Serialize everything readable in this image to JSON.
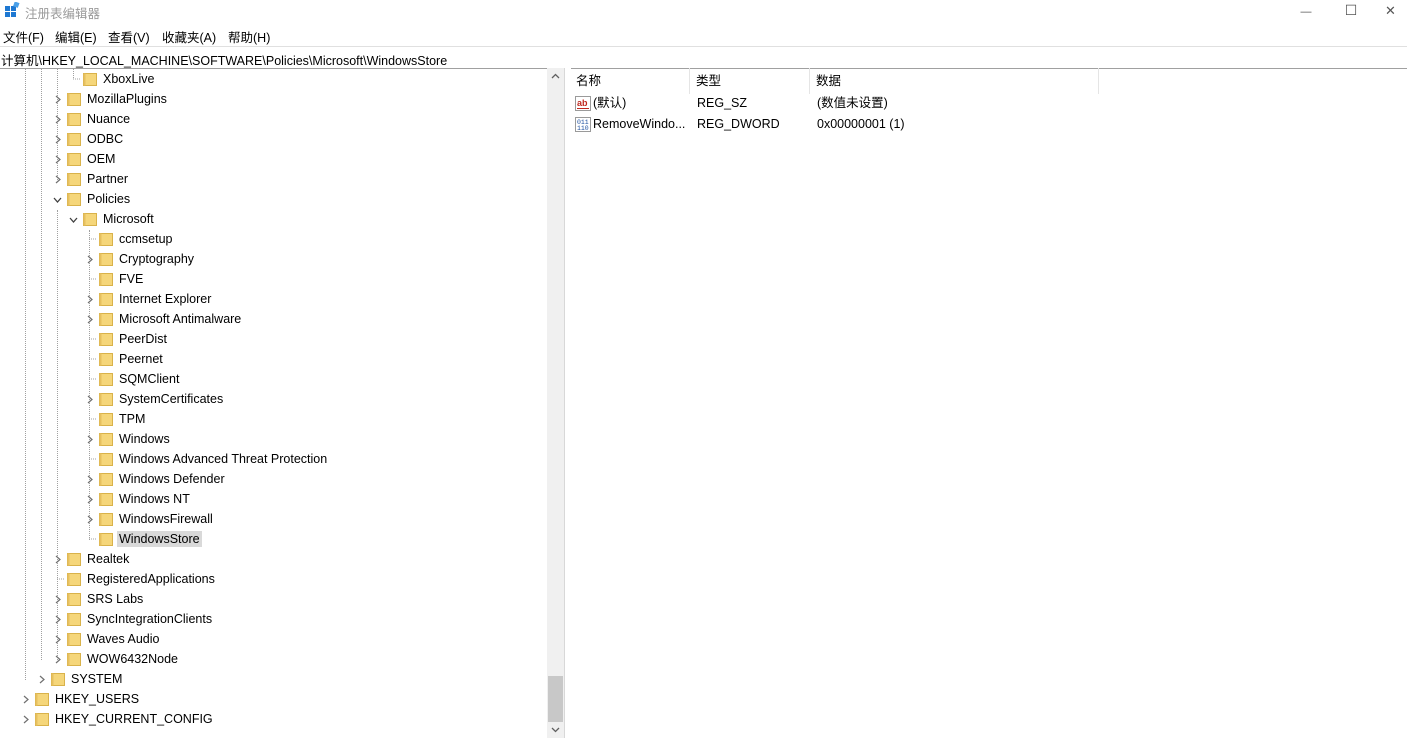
{
  "window": {
    "title": "注册表编辑器",
    "minimize_glyph": "—",
    "maximize_glyph": "☐",
    "close_glyph": "✕"
  },
  "menu": [
    "文件(F)",
    "编辑(E)",
    "查看(V)",
    "收藏夹(A)",
    "帮助(H)"
  ],
  "address": "计算机\\HKEY_LOCAL_MACHINE\\SOFTWARE\\Policies\\Microsoft\\WindowsStore",
  "tree": [
    {
      "label": "XboxLive",
      "depth": 3,
      "expander": "none",
      "selected": false
    },
    {
      "label": "MozillaPlugins",
      "depth": 2,
      "expander": "collapsed",
      "selected": false
    },
    {
      "label": "Nuance",
      "depth": 2,
      "expander": "collapsed",
      "selected": false
    },
    {
      "label": "ODBC",
      "depth": 2,
      "expander": "collapsed",
      "selected": false
    },
    {
      "label": "OEM",
      "depth": 2,
      "expander": "collapsed",
      "selected": false
    },
    {
      "label": "Partner",
      "depth": 2,
      "expander": "collapsed",
      "selected": false
    },
    {
      "label": "Policies",
      "depth": 2,
      "expander": "expanded",
      "selected": false
    },
    {
      "label": "Microsoft",
      "depth": 3,
      "expander": "expanded",
      "selected": false
    },
    {
      "label": "ccmsetup",
      "depth": 4,
      "expander": "none",
      "selected": false
    },
    {
      "label": "Cryptography",
      "depth": 4,
      "expander": "collapsed",
      "selected": false
    },
    {
      "label": "FVE",
      "depth": 4,
      "expander": "none",
      "selected": false
    },
    {
      "label": "Internet Explorer",
      "depth": 4,
      "expander": "collapsed",
      "selected": false
    },
    {
      "label": "Microsoft Antimalware",
      "depth": 4,
      "expander": "collapsed",
      "selected": false
    },
    {
      "label": "PeerDist",
      "depth": 4,
      "expander": "none",
      "selected": false
    },
    {
      "label": "Peernet",
      "depth": 4,
      "expander": "none",
      "selected": false
    },
    {
      "label": "SQMClient",
      "depth": 4,
      "expander": "none",
      "selected": false
    },
    {
      "label": "SystemCertificates",
      "depth": 4,
      "expander": "collapsed",
      "selected": false
    },
    {
      "label": "TPM",
      "depth": 4,
      "expander": "none",
      "selected": false
    },
    {
      "label": "Windows",
      "depth": 4,
      "expander": "collapsed",
      "selected": false
    },
    {
      "label": "Windows Advanced Threat Protection",
      "depth": 4,
      "expander": "none",
      "selected": false
    },
    {
      "label": "Windows Defender",
      "depth": 4,
      "expander": "collapsed",
      "selected": false
    },
    {
      "label": "Windows NT",
      "depth": 4,
      "expander": "collapsed",
      "selected": false
    },
    {
      "label": "WindowsFirewall",
      "depth": 4,
      "expander": "collapsed",
      "selected": false
    },
    {
      "label": "WindowsStore",
      "depth": 4,
      "expander": "none",
      "selected": true
    },
    {
      "label": "Realtek",
      "depth": 2,
      "expander": "collapsed",
      "selected": false
    },
    {
      "label": "RegisteredApplications",
      "depth": 2,
      "expander": "none",
      "selected": false
    },
    {
      "label": "SRS Labs",
      "depth": 2,
      "expander": "collapsed",
      "selected": false
    },
    {
      "label": "SyncIntegrationClients",
      "depth": 2,
      "expander": "collapsed",
      "selected": false
    },
    {
      "label": "Waves Audio",
      "depth": 2,
      "expander": "collapsed",
      "selected": false
    },
    {
      "label": "WOW6432Node",
      "depth": 2,
      "expander": "collapsed",
      "selected": false
    },
    {
      "label": "SYSTEM",
      "depth": 1,
      "expander": "collapsed",
      "selected": false
    },
    {
      "label": "HKEY_USERS",
      "depth": 0,
      "expander": "collapsed",
      "selected": false
    },
    {
      "label": "HKEY_CURRENT_CONFIG",
      "depth": 0,
      "expander": "collapsed",
      "selected": false
    }
  ],
  "list": {
    "columns": [
      "名称",
      "类型",
      "数据"
    ],
    "rows": [
      {
        "name": "(默认)",
        "type": "REG_SZ",
        "data": "(数值未设置)",
        "icon": "string-value-icon"
      },
      {
        "name": "RemoveWindo...",
        "type": "REG_DWORD",
        "data": "0x00000001 (1)",
        "icon": "binary-value-icon"
      }
    ]
  },
  "colors": {
    "folder": "#f5d67a",
    "folder_edge": "#d9b24a",
    "selected_bg": "#d9d9d9",
    "scrollbar_thumb": "#c8c8c8"
  }
}
